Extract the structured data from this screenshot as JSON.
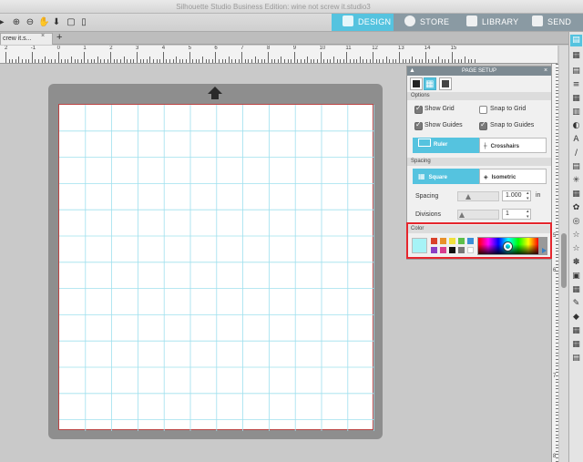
{
  "window": {
    "title": "Silhouette Studio Business Edition: wine not screw it.studio3"
  },
  "nav": [
    {
      "label": "DESIGN",
      "active": true
    },
    {
      "label": "STORE",
      "active": false
    },
    {
      "label": "LIBRARY",
      "active": false
    },
    {
      "label": "SEND",
      "active": false
    }
  ],
  "toolbar_icons": [
    "zoom-in-icon",
    "zoom-out-icon",
    "pan-icon",
    "move-down-icon",
    "fit-icon"
  ],
  "tabs": {
    "document": "crew it.s...",
    "close": "×",
    "add": "+"
  },
  "ruler": {
    "top_labels": [
      "2",
      "-1",
      "0",
      "1",
      "2",
      "3",
      "4",
      "5",
      "6",
      "7",
      "8",
      "9",
      "10",
      "11",
      "12",
      "13",
      "14",
      "15"
    ],
    "right_labels": [
      "5",
      "6",
      "7",
      "8"
    ]
  },
  "page_setup": {
    "title": "PAGE SETUP",
    "options_header": "Options",
    "show_grid": {
      "label": "Show Grid",
      "checked": true
    },
    "snap_to_grid": {
      "label": "Snap to Grid",
      "checked": false
    },
    "show_guides": {
      "label": "Show Guides",
      "checked": true
    },
    "snap_to_guides": {
      "label": "Snap to Guides",
      "checked": true
    },
    "ruler_btn": "Ruler",
    "crosshairs_btn": "Crosshairs",
    "spacing_header": "Spacing",
    "square_btn": "Square",
    "isometric_btn": "Isometric",
    "spacing": {
      "label": "Spacing",
      "value": "1.000",
      "unit": "in"
    },
    "divisions": {
      "label": "Divisions",
      "value": "1"
    },
    "color_header": "Color",
    "selected_color": "#a6f3f6",
    "swatches": [
      "#d9412a",
      "#e8902a",
      "#f0e03c",
      "#5cbf4a",
      "#3b8fd8",
      "#8a3fc4",
      "#d83c8e",
      "#111111",
      "#777777",
      "#ffffff"
    ]
  },
  "accent_color": "#55c3df",
  "highlight_color": "#e5262d"
}
